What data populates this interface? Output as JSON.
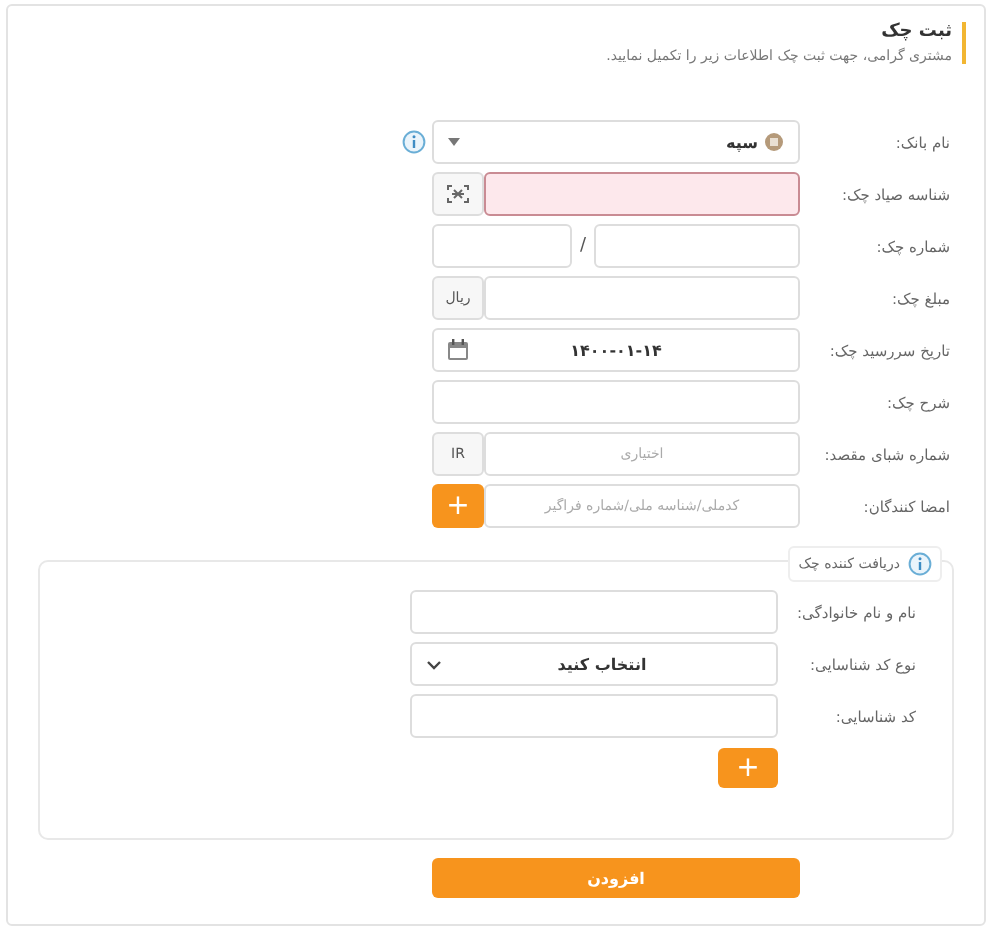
{
  "header": {
    "title": "ثبت چک",
    "subtitle": "مشتری گرامی، جهت ثبت چک اطلاعات زیر را تکمیل نمایید."
  },
  "fields": [
    {
      "kind": "select",
      "label": "نام بانک:",
      "value": "سپه",
      "info": true
    },
    {
      "kind": "scan",
      "label": "شناسه صیاد چک:",
      "invalid": true
    },
    {
      "kind": "split",
      "label": "شماره چک:",
      "separator": "/"
    },
    {
      "kind": "addon",
      "label": "مبلغ چک:",
      "addon": "ریال"
    },
    {
      "kind": "date",
      "label": "تاریخ سررسید چک:",
      "value": "۱۴۰۰-۰۱-۱۴"
    },
    {
      "kind": "text",
      "label": "شرح چک:"
    },
    {
      "kind": "addon",
      "label": "شماره شبای مقصد:",
      "addon": "IR",
      "placeholder": "اختیاری"
    },
    {
      "kind": "add",
      "label": "امضا کنندگان:",
      "placeholder": "کدملی/شناسه ملی/شماره فراگیر",
      "button": "+"
    }
  ],
  "recipient": {
    "legend": "دریافت کننده چک",
    "fields": [
      {
        "kind": "text",
        "label": "نام و نام خانوادگی:"
      },
      {
        "kind": "dropdown",
        "label": "نوع کد شناسایی:",
        "value": "انتخاب کنید"
      },
      {
        "kind": "text",
        "label": "کد شناسایی:"
      }
    ],
    "add_button": "+"
  },
  "submit": "افزودن"
}
